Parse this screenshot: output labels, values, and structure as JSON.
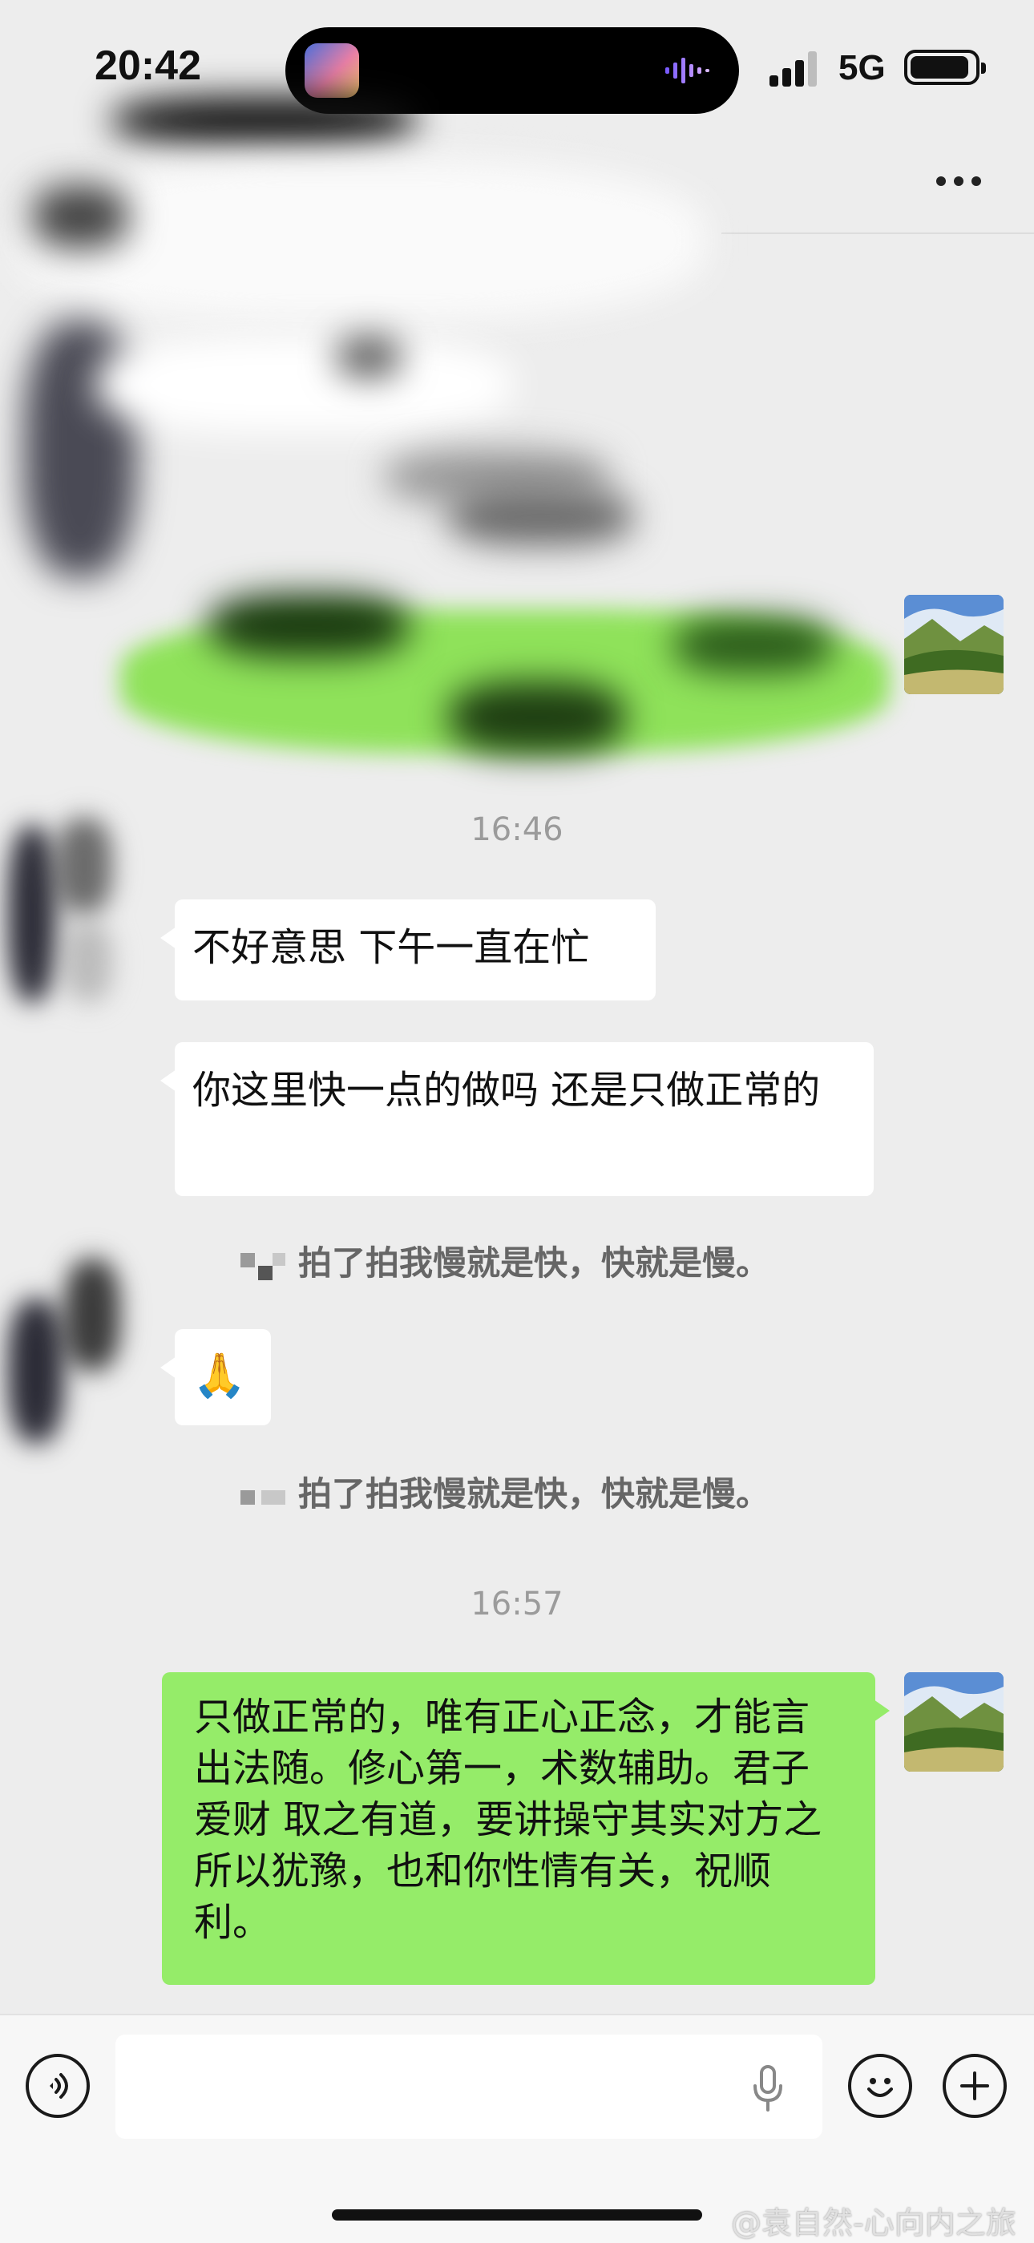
{
  "status_bar": {
    "time": "20:42",
    "network": "5G"
  },
  "chat": {
    "messages": [
      {
        "type": "timestamp",
        "text": "16:46"
      },
      {
        "type": "text",
        "from": "other",
        "text": "不好意思 下午一直在忙"
      },
      {
        "type": "text",
        "from": "other",
        "text": "你这里快一点的做吗 还是只做正常的"
      },
      {
        "type": "system",
        "text": "拍了拍我慢就是快，快就是慢。"
      },
      {
        "type": "emoji",
        "from": "other",
        "text": "🙏"
      },
      {
        "type": "system",
        "text": "拍了拍我慢就是快，快就是慢。"
      },
      {
        "type": "timestamp",
        "text": "16:57"
      },
      {
        "type": "text",
        "from": "self",
        "text": "只做正常的，唯有正心正念，才能言出法随。修心第一，术数辅助。君子爱财 取之有道，要讲操守其实对方之所以犹豫，也和你性情有关，祝顺利。"
      }
    ]
  },
  "watermark": "@袁自然-心向内之旅",
  "colors": {
    "self_bubble": "#95ec69",
    "other_bubble": "#ffffff",
    "background": "#ededed"
  },
  "icons": [
    "more-icon",
    "voice-toggle-icon",
    "microphone-icon",
    "emoji-icon",
    "plus-icon"
  ]
}
